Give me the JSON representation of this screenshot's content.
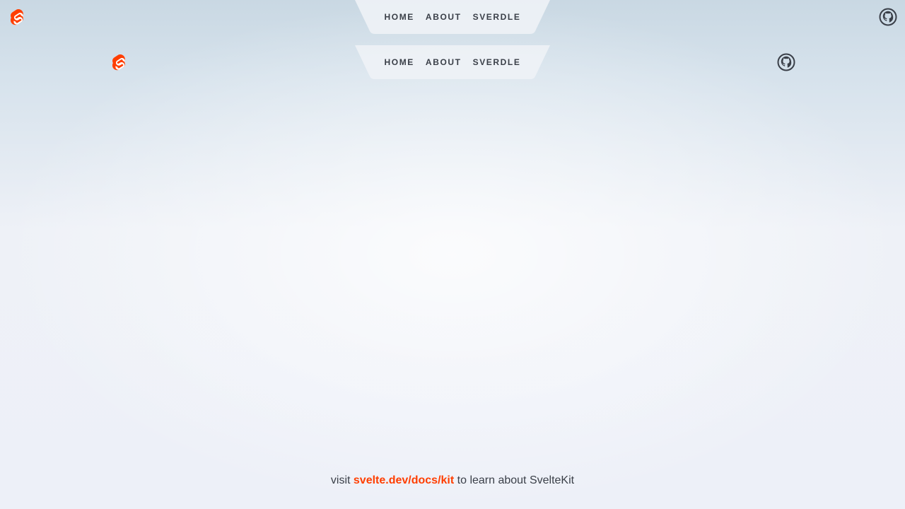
{
  "colors": {
    "accent": "#ff3e00",
    "text": "#3a3f48",
    "nav_bg": "#eef2f6"
  },
  "header_top": {
    "logo_icon": "svelte-logo-icon",
    "nav": [
      {
        "label": "Home"
      },
      {
        "label": "About"
      },
      {
        "label": "Sverdle"
      }
    ],
    "github_icon": "github-icon"
  },
  "header_inner": {
    "logo_icon": "svelte-logo-icon",
    "nav": [
      {
        "label": "Home"
      },
      {
        "label": "About"
      },
      {
        "label": "Sverdle"
      }
    ],
    "github_icon": "github-icon"
  },
  "footer": {
    "prefix": "visit ",
    "link": "svelte.dev/docs/kit",
    "suffix": " to learn about SvelteKit"
  }
}
